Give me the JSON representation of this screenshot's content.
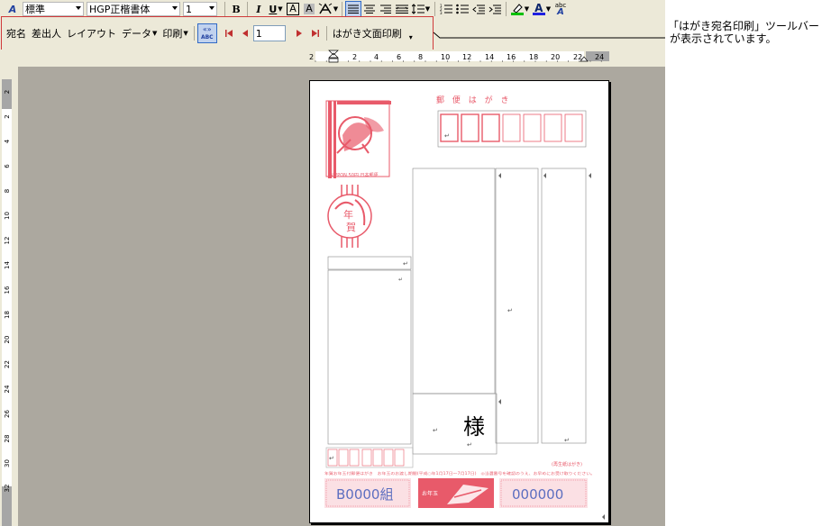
{
  "toolbar1": {
    "style_value": "標準",
    "font_value": "HGP正楷書体",
    "size_value": "1",
    "bold": "B",
    "italic": "I",
    "underline": "U",
    "char_border": "A",
    "char_shade": "A",
    "font_color_glyph": "A",
    "abc_label": "abc"
  },
  "toolbar2": {
    "menu_atena": "宛名",
    "menu_sashidashinin": "差出人",
    "menu_layout": "レイアウト",
    "menu_data": "データ",
    "menu_insatsu": "印刷",
    "abc_badge": "ABC",
    "record_number": "1",
    "hagaki_print_label": "はがき文面印刷"
  },
  "ruler": {
    "horizontal_ticks": [
      "2",
      "2",
      "4",
      "6",
      "8",
      "10",
      "12",
      "14",
      "16",
      "18",
      "20",
      "22",
      "24"
    ],
    "vertical_ticks": [
      "2",
      "2",
      "4",
      "6",
      "8",
      "10",
      "12",
      "14",
      "16",
      "18",
      "20",
      "22",
      "24",
      "26",
      "28",
      "30",
      "32"
    ]
  },
  "postcard": {
    "title": "郵 便 は が き",
    "stamp_caption": "NIPPON 50円 日本郵便",
    "nenga_char1": "年",
    "nenga_char2": "賀",
    "sama": "様",
    "lottery_group": "B0000組",
    "lottery_number": "000000",
    "otoshidama": "お年玉",
    "recycle_note": "(再生紙はがき)",
    "footer_note": "年賀お年玉付郵便はがき　お年玉のお渡し期間(平成○年1月17日〜7月17日)　◎当選番号を確認のうえ、お早めにお受け取りください。"
  },
  "annotation": {
    "line1": "「はがき宛名印刷」ツールバー",
    "line2": "が表示されています。"
  },
  "colors": {
    "stamp_red": "#e85a6a",
    "frame_red": "#d03a3a",
    "lottery_blue": "#5c6ec0",
    "workspace_grey": "#aca89f",
    "toolbar_bg": "#ece9d8"
  }
}
